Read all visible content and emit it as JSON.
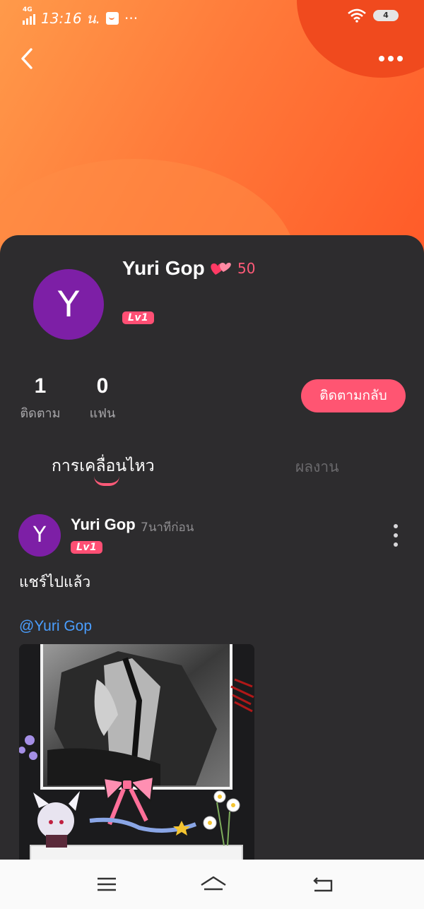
{
  "status_bar": {
    "network": "4G",
    "time": "13:16 น.",
    "more": "···",
    "battery": "4"
  },
  "profile": {
    "name": "Yuri Gop",
    "avatar_letter": "Y",
    "heart_count": "50",
    "level": "Lv1"
  },
  "stats": {
    "following_count": "1",
    "following_label": "ติดตาม",
    "fans_count": "0",
    "fans_label": "แฟน"
  },
  "follow_button": "ติดตามกลับ",
  "tabs": {
    "activity": "การเคลื่อนไหว",
    "works": "ผลงาน"
  },
  "post": {
    "author": "Yuri Gop",
    "avatar_letter": "Y",
    "time": "7นาทีก่อน",
    "level": "Lv1",
    "text": "แชร์ไปแล้ว",
    "mention": "@Yuri Gop"
  },
  "colors": {
    "accent": "#ff5572",
    "header_start": "#ff9a4a",
    "header_end": "#ff5a28",
    "avatar": "#7d1fa6",
    "mention": "#4a9eff",
    "background": "#2d2c2e"
  },
  "icons": {
    "back": "chevron-left-icon",
    "more": "more-horizontal-icon",
    "post_menu": "more-vertical-icon",
    "nav_menu": "menu-icon",
    "nav_home": "home-icon",
    "nav_back": "back-icon"
  }
}
